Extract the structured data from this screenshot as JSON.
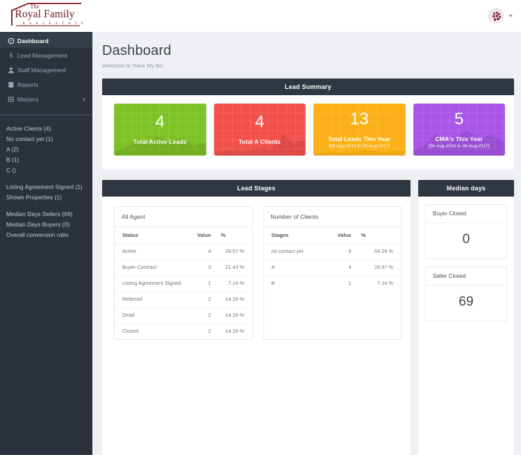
{
  "brand": {
    "logo_the": "The",
    "logo_name": "Royal Family",
    "logo_tagline": "R E A L   E S T A T E",
    "accent_color": "#6e161c"
  },
  "topbar": {
    "avatar_name": "avatar",
    "caret_name": "chevron-down-icon"
  },
  "sidebar": {
    "items": [
      {
        "label": "Dashboard",
        "icon": "dashboard-icon",
        "active": true,
        "has_arrow": false
      },
      {
        "label": "Lead Management",
        "icon": "dollar-icon",
        "active": false,
        "has_arrow": false
      },
      {
        "label": "Staff Management",
        "icon": "user-icon",
        "active": false,
        "has_arrow": false
      },
      {
        "label": "Reports",
        "icon": "report-icon",
        "active": false,
        "has_arrow": false
      },
      {
        "label": "Masters",
        "icon": "grid-icon",
        "active": false,
        "has_arrow": true
      }
    ],
    "stats_group_1": [
      "Active Clients (4)",
      "No contact yet (1)",
      "A (2)",
      "B (1)",
      "C ()"
    ],
    "stats_group_2": [
      "Listing Agreement Signed (1)",
      "Shown Properties (1)"
    ],
    "stats_group_3": [
      "Median Days Sellers (69)",
      "Median Days Buyers (0)",
      "Overall conversion ratio"
    ]
  },
  "page": {
    "title": "Dashboard",
    "subtitle": "Welcome to Track My Biz"
  },
  "lead_summary": {
    "header": "Lead Summary",
    "cards": [
      {
        "value": "4",
        "label": "Total Active Leads",
        "date": "",
        "color": "#7ec225"
      },
      {
        "value": "4",
        "label": "Total A Clients",
        "date": "",
        "color": "#f2504b"
      },
      {
        "value": "13",
        "label": "Total Leads This Year",
        "date": "[08-Aug-2016 to 08-Aug-2017]",
        "color": "#fbb116"
      },
      {
        "value": "5",
        "label": "CMA's This Year",
        "date": "[08-Aug-2016 to 08-Aug-2017]",
        "color": "#a855e8"
      }
    ]
  },
  "lead_stages": {
    "header": "Lead Stages",
    "all_agent": {
      "title": "All Agent",
      "columns": [
        "Status",
        "Value",
        "%"
      ],
      "rows": [
        {
          "status": "Active",
          "value": "4",
          "pct": "28.57 %"
        },
        {
          "status": "Buyer Contract",
          "value": "3",
          "pct": "21.43 %"
        },
        {
          "status": "Listing Agreement Signed",
          "value": "1",
          "pct": "7.14 %"
        },
        {
          "status": "Referred",
          "value": "2",
          "pct": "14.29 %"
        },
        {
          "status": "Dead",
          "value": "2",
          "pct": "14.29 %"
        },
        {
          "status": "Closed",
          "value": "2",
          "pct": "14.29 %"
        }
      ]
    },
    "number_of_clients": {
      "title": "Number of Clients",
      "columns": [
        "Stages",
        "Value",
        "%"
      ],
      "rows": [
        {
          "stage": "no contact yet",
          "value": "9",
          "pct": "64.29 %"
        },
        {
          "stage": "A",
          "value": "4",
          "pct": "28.57 %"
        },
        {
          "stage": "B",
          "value": "1",
          "pct": "7.14 %"
        }
      ]
    }
  },
  "median_days": {
    "header": "Median days",
    "cards": [
      {
        "label": "Buyer Closed",
        "value": "0"
      },
      {
        "label": "Seller Closed",
        "value": "69"
      }
    ]
  }
}
